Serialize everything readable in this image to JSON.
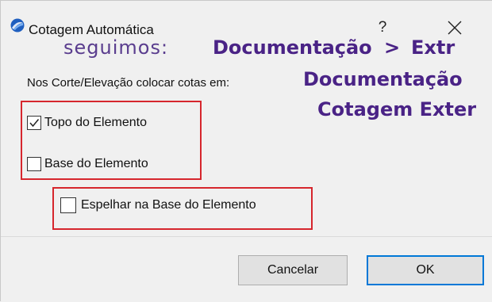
{
  "window": {
    "title": "Cotagem Automática",
    "help_glyph": "?",
    "icon": "archicad-app-icon",
    "close_icon": "close-icon"
  },
  "overlay": {
    "seguimos": "seguimos:",
    "documentacao_1": "Documentação",
    "separator": ">",
    "extr": "Extr",
    "documentacao_2": "Documentação",
    "cotagem_exter": "Cotagem Exter"
  },
  "prompt": "Nos Corte/Elevação colocar cotas em:",
  "options": [
    {
      "label": "Topo do Elemento",
      "checked": true
    },
    {
      "label": "Base do Elemento",
      "checked": false
    },
    {
      "label": "Espelhar na Base do Elemento",
      "checked": false
    }
  ],
  "buttons": {
    "cancel": "Cancelar",
    "ok": "OK"
  },
  "colors": {
    "overlay_text": "#4a2386",
    "highlight_border": "#d6262d",
    "default_button_border": "#0078d7",
    "dialog_background": "#f0f0f0"
  }
}
